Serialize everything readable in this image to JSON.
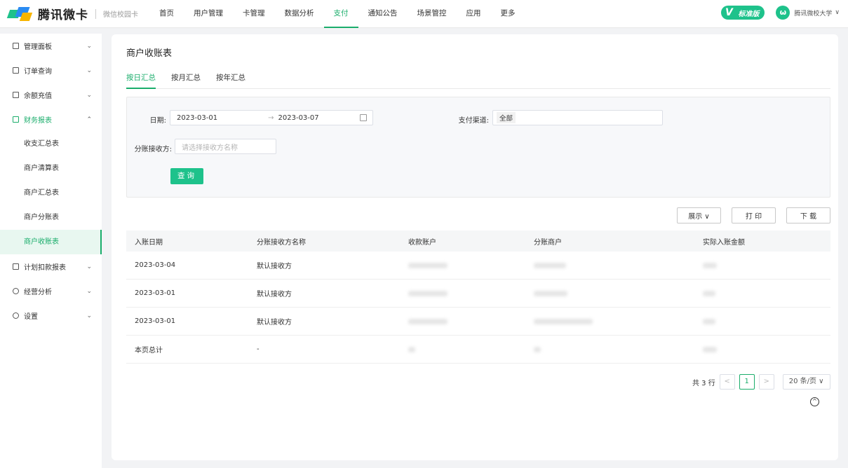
{
  "brand": {
    "name": "腾讯微卡",
    "sub": "微信校园卡"
  },
  "nav": [
    "首页",
    "用户管理",
    "卡管理",
    "数据分析",
    "支付",
    "通知公告",
    "场景管控",
    "应用",
    "更多"
  ],
  "nav_active_index": 4,
  "edition": {
    "mark": "V",
    "label": "标准版"
  },
  "user": {
    "avatar": "ω",
    "name": "腾讯微校大学",
    "caret": "∨"
  },
  "sidebar": {
    "items": [
      {
        "label": "管理面板",
        "caret": "⌄"
      },
      {
        "label": "订单查询",
        "caret": "⌄"
      },
      {
        "label": "余额充值",
        "caret": "⌄"
      },
      {
        "label": "财务报表",
        "caret": "⌃"
      },
      {
        "label": "计划扣款报表",
        "caret": "⌄"
      },
      {
        "label": "经营分析",
        "caret": "⌄"
      },
      {
        "label": "设置",
        "caret": "⌄"
      }
    ],
    "sub_items": [
      "收支汇总表",
      "商户清算表",
      "商户汇总表",
      "商户分账表",
      "商户收账表"
    ]
  },
  "page": {
    "title": "商户收账表",
    "tabs": [
      "按日汇总",
      "按月汇总",
      "按年汇总"
    ]
  },
  "filter": {
    "date_label": "日期:",
    "date_start": "2023-03-01",
    "date_sep": "→",
    "date_end": "2023-03-07",
    "channel_label": "支付渠道:",
    "channel_value": "全部",
    "receiver_label": "分账接收方:",
    "receiver_placeholder": "请选择接收方名称",
    "query_label": "查询"
  },
  "actions": {
    "display": "展示 ∨",
    "print": "打 印",
    "download": "下 载"
  },
  "table": {
    "columns": [
      "入账日期",
      "分账接收方名称",
      "收款账户",
      "分账商户",
      "实际入账金额"
    ],
    "rows": [
      {
        "date": "2023-03-04",
        "receiver": "默认接收方"
      },
      {
        "date": "2023-03-01",
        "receiver": "默认接收方"
      },
      {
        "date": "2023-03-01",
        "receiver": "默认接收方"
      }
    ],
    "total_label": "本页总计",
    "total_receiver": "-"
  },
  "pagination": {
    "total": "共 3 行",
    "prev": "<",
    "current": "1",
    "next": ">",
    "page_size": "20 条/页 ∨"
  },
  "back_top": "^"
}
